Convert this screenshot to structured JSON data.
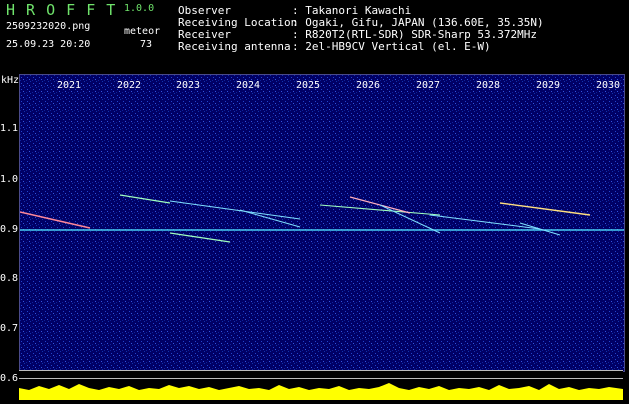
{
  "app": {
    "title": "H R O F F T",
    "version": "1.0.0",
    "filename": "2509232020.png",
    "datetime": "25.09.23 20:20",
    "meteor_label": "meteor",
    "meteor_count": "73"
  },
  "info": {
    "labels": [
      "Observer",
      "Receiving Location",
      "Receiver",
      "Receiving antenna"
    ],
    "values": [
      ": Takanori Kawachi",
      ": Ogaki, Gifu, JAPAN (136.60E, 35.35N)",
      ": R820T2(RTL-SDR) SDR-Sharp 53.372MHz",
      ": 2el-HB9CV Vertical (el. E-W)"
    ]
  },
  "axes": {
    "y_unit": "kHz",
    "y_ticks": [
      "1.1",
      "1.0",
      "0.9",
      "0.8",
      "0.7",
      "0.6"
    ],
    "x_ticks": [
      "2021",
      "2022",
      "2023",
      "2024",
      "2025",
      "2026",
      "2027",
      "2028",
      "2029",
      "2030"
    ]
  },
  "colors": {
    "background": "#000000",
    "spectrogram": "#000066",
    "title_green": "#6fe36b",
    "signal_yellow": "#ffff00",
    "carrier_cyan": "#4fe0ff"
  }
}
